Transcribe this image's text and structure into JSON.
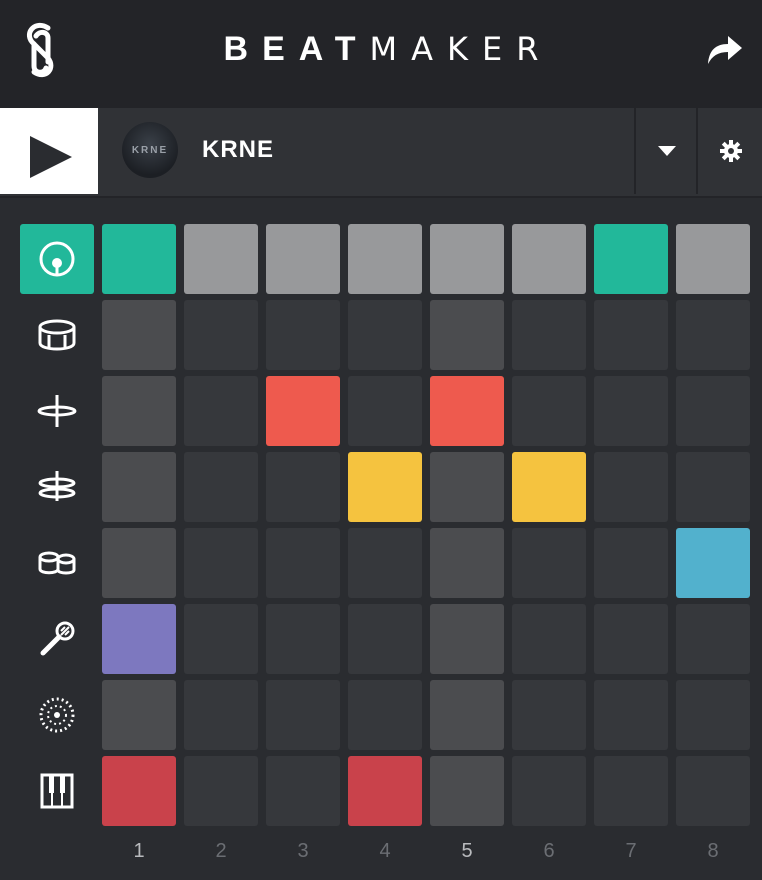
{
  "header": {
    "title_bold": "BEAT",
    "title_light": "MAKER",
    "logo_icon": "s-logo-icon",
    "share_icon": "share-arrow-icon"
  },
  "kit": {
    "name": "KRNE",
    "avatar_text": "KRNE",
    "play_icon": "play-icon",
    "dropdown_icon": "caret-down-icon",
    "settings_icon": "gear-icon"
  },
  "colors": {
    "accent": "#22b89a",
    "teal": "#22b89a",
    "gray_light": "#98999b",
    "cell_dark": "#36383c",
    "cell_beat": "#4b4c4f",
    "red": "#ee5a4e",
    "yellow": "#f5c33f",
    "blue": "#52b1cd",
    "purple": "#7d78bf",
    "crimson": "#c9424b"
  },
  "instruments": [
    {
      "name": "kick-drum-icon",
      "active": true
    },
    {
      "name": "snare-drum-icon",
      "active": false
    },
    {
      "name": "hi-hat-icon",
      "active": false
    },
    {
      "name": "cymbal-icon",
      "active": false
    },
    {
      "name": "bongos-icon",
      "active": false
    },
    {
      "name": "microphone-icon",
      "active": false
    },
    {
      "name": "tambourine-icon",
      "active": false
    },
    {
      "name": "piano-keys-icon",
      "active": false
    }
  ],
  "grid": [
    [
      "teal",
      "gray_light",
      "gray_light",
      "gray_light",
      "gray_light",
      "gray_light",
      "teal",
      "gray_light"
    ],
    [
      "cell_beat",
      "cell_dark",
      "cell_dark",
      "cell_dark",
      "cell_beat",
      "cell_dark",
      "cell_dark",
      "cell_dark"
    ],
    [
      "cell_beat",
      "cell_dark",
      "red",
      "cell_dark",
      "red",
      "cell_dark",
      "cell_dark",
      "cell_dark"
    ],
    [
      "cell_beat",
      "cell_dark",
      "cell_dark",
      "yellow",
      "cell_beat",
      "yellow",
      "cell_dark",
      "cell_dark"
    ],
    [
      "cell_beat",
      "cell_dark",
      "cell_dark",
      "cell_dark",
      "cell_beat",
      "cell_dark",
      "cell_dark",
      "blue"
    ],
    [
      "purple",
      "cell_dark",
      "cell_dark",
      "cell_dark",
      "cell_beat",
      "cell_dark",
      "cell_dark",
      "cell_dark"
    ],
    [
      "cell_beat",
      "cell_dark",
      "cell_dark",
      "cell_dark",
      "cell_beat",
      "cell_dark",
      "cell_dark",
      "cell_dark"
    ],
    [
      "crimson",
      "cell_dark",
      "cell_dark",
      "crimson",
      "cell_beat",
      "cell_dark",
      "cell_dark",
      "cell_dark"
    ]
  ],
  "steps": [
    "1",
    "2",
    "3",
    "4",
    "5",
    "6",
    "7",
    "8"
  ]
}
